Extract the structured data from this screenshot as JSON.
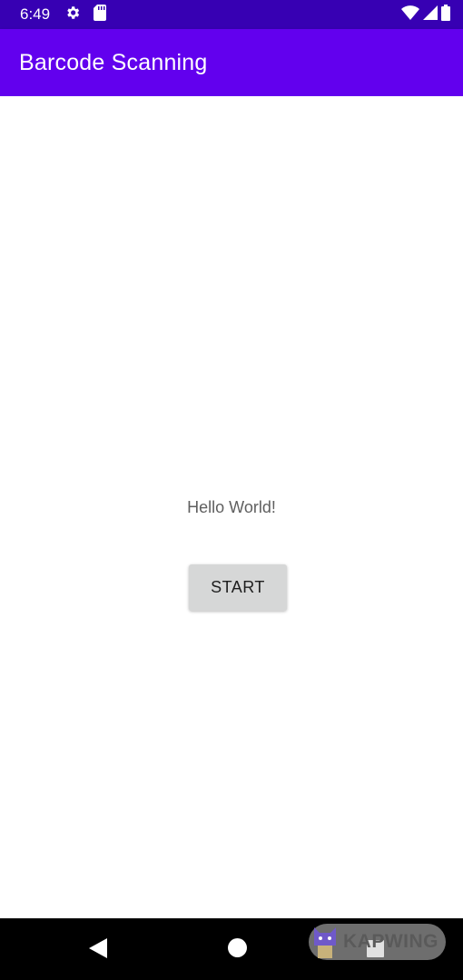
{
  "status_bar": {
    "time": "6:49",
    "left_icons": [
      "settings-icon",
      "sd-card-icon"
    ],
    "right_icons": [
      "wifi-icon",
      "signal-icon",
      "battery-icon"
    ],
    "color": "#3700b3"
  },
  "app_bar": {
    "title": "Barcode Scanning",
    "color": "#6200ee"
  },
  "main": {
    "hello_text": "Hello World!",
    "start_label": "START"
  },
  "nav_bar": {
    "icons": [
      "back-icon",
      "home-icon",
      "recents-icon"
    ]
  },
  "watermark": {
    "text": "KAPWING"
  }
}
